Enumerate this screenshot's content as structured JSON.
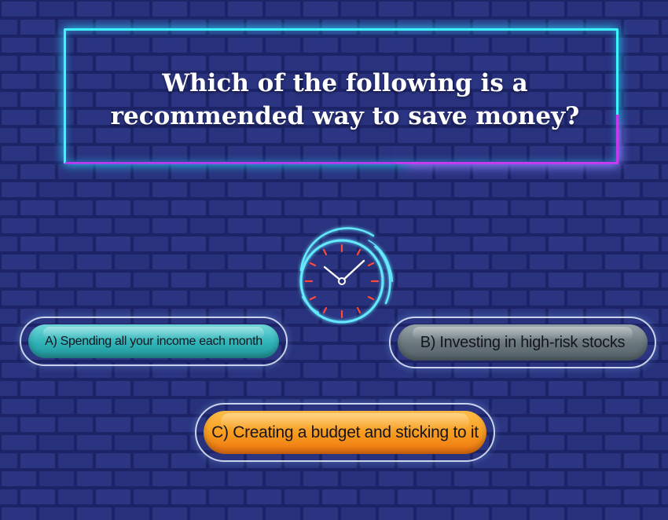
{
  "question": {
    "text": "Which of the following is a recommended way to save money?"
  },
  "answers": [
    {
      "label": "A) Spending all your income each month",
      "color": "#2fb2b6"
    },
    {
      "label": "B) Investing in high-risk stocks",
      "color": "#68767c"
    },
    {
      "label": "C) Creating a budget and sticking to it",
      "color": "#f79a1e"
    }
  ],
  "theme": {
    "background": "#232c74",
    "brick_mortar": "#1a2160",
    "neon_cyan": "#3ef3ff",
    "neon_purple": "#c33bf0",
    "timer_tick": "#ff4a3a"
  },
  "timer": {
    "icon": "stopwatch-icon"
  }
}
